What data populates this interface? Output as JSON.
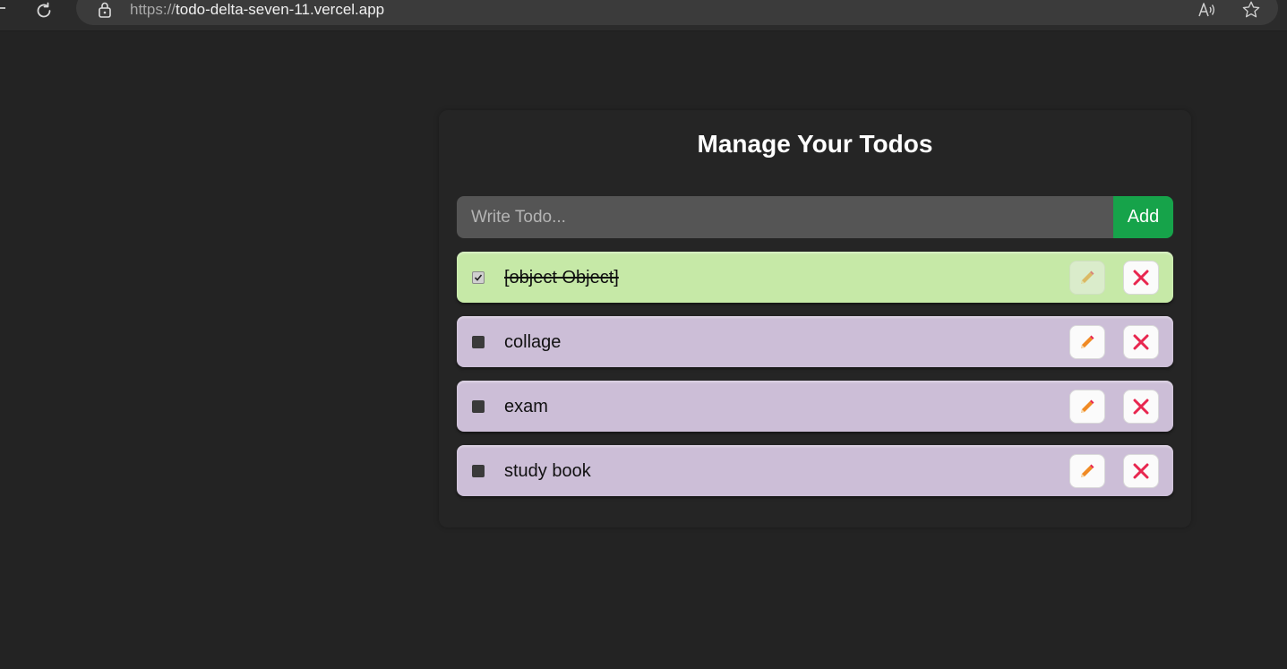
{
  "browser": {
    "url_scheme": "https://",
    "url_host": "todo-delta-seven-11.vercel.app"
  },
  "app": {
    "title": "Manage Your Todos",
    "input": {
      "placeholder": "Write Todo...",
      "value": ""
    },
    "add_label": "Add",
    "todos": [
      {
        "text": "[object Object]",
        "completed": true
      },
      {
        "text": "collage",
        "completed": false
      },
      {
        "text": "exam",
        "completed": false
      },
      {
        "text": "study book",
        "completed": false
      }
    ]
  },
  "colors": {
    "page_bg": "#232323",
    "completed_item_bg": "#c6e9a7",
    "pending_item_bg": "#ccbed7",
    "add_button": "#16a34a",
    "edit_icon": "#f08a24",
    "delete_icon": "#e8264f"
  },
  "icons": {
    "reload": "reload-icon",
    "lock": "lock-icon",
    "read_aloud": "read-aloud-icon",
    "favorite": "star-icon",
    "edit": "pencil-icon",
    "delete": "close-icon"
  }
}
